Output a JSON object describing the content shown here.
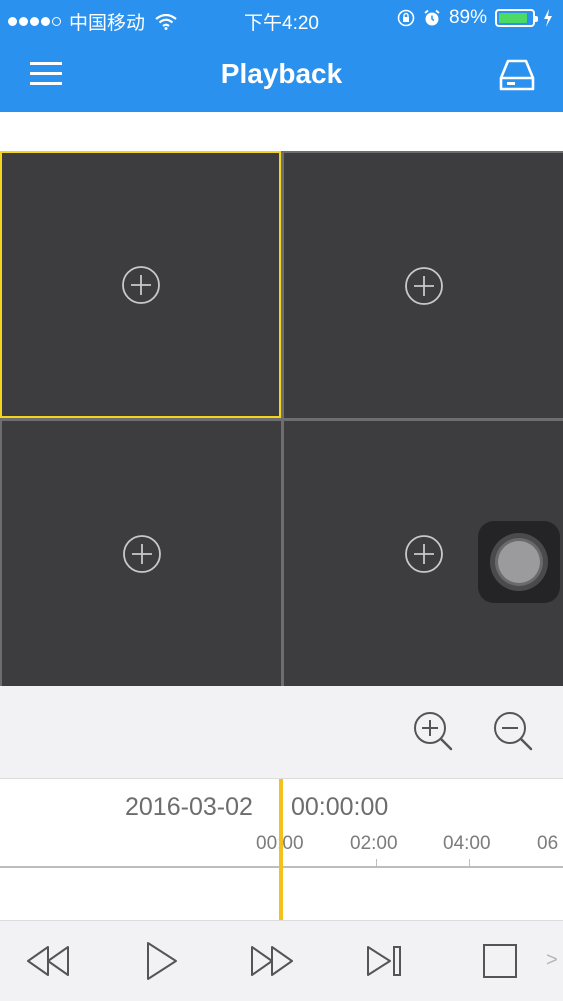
{
  "status_bar": {
    "carrier": "中国移动",
    "time": "下午4:20",
    "battery_percent": "89%",
    "battery_level": 0.89,
    "signal_bars_filled": 4,
    "signal_bars_total": 5,
    "icons": [
      "wifi-icon",
      "rotation-lock-icon",
      "alarm-icon",
      "battery-icon",
      "charging-icon"
    ],
    "battery_color": "#4cd964"
  },
  "nav": {
    "title": "Playback",
    "left_icon": "menu-icon",
    "right_icon": "storage-drive-icon",
    "bar_color": "#2a91ee"
  },
  "grid": {
    "cells": [
      {
        "icon": "add-channel-icon",
        "selected": true
      },
      {
        "icon": "add-channel-icon",
        "selected": false
      },
      {
        "icon": "add-channel-icon",
        "selected": false
      },
      {
        "icon": "add-channel-icon",
        "selected": false
      }
    ],
    "selected_border_color": "#f5d51b"
  },
  "zoom": {
    "zoom_in_icon": "zoom-in-icon",
    "zoom_out_icon": "zoom-out-icon"
  },
  "timeline": {
    "date": "2016-03-02",
    "time": "00:00:00",
    "ticks": [
      "00:00",
      "02:00",
      "04:00",
      "06"
    ],
    "cursor_color": "#f2c21b"
  },
  "controls": {
    "buttons": [
      "rewind-icon",
      "play-icon",
      "fast-forward-icon",
      "step-forward-icon",
      "stop-icon"
    ],
    "more": ">"
  }
}
